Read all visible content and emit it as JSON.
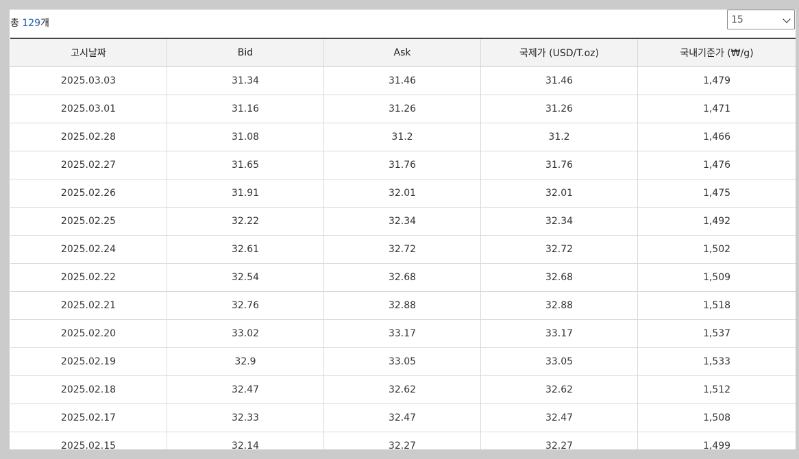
{
  "summary": {
    "prefix": "총 ",
    "count": "129",
    "suffix": "개"
  },
  "page_size_select": {
    "value": "15",
    "icon": "chevron-down-icon"
  },
  "table": {
    "headers": [
      "고시날짜",
      "Bid",
      "Ask",
      "국제가 (USD/T.oz)",
      "국내기준가 (₩/g)"
    ],
    "rows": [
      [
        "2025.03.03",
        "31.34",
        "31.46",
        "31.46",
        "1,479"
      ],
      [
        "2025.03.01",
        "31.16",
        "31.26",
        "31.26",
        "1,471"
      ],
      [
        "2025.02.28",
        "31.08",
        "31.2",
        "31.2",
        "1,466"
      ],
      [
        "2025.02.27",
        "31.65",
        "31.76",
        "31.76",
        "1,476"
      ],
      [
        "2025.02.26",
        "31.91",
        "32.01",
        "32.01",
        "1,475"
      ],
      [
        "2025.02.25",
        "32.22",
        "32.34",
        "32.34",
        "1,492"
      ],
      [
        "2025.02.24",
        "32.61",
        "32.72",
        "32.72",
        "1,502"
      ],
      [
        "2025.02.22",
        "32.54",
        "32.68",
        "32.68",
        "1,509"
      ],
      [
        "2025.02.21",
        "32.76",
        "32.88",
        "32.88",
        "1,518"
      ],
      [
        "2025.02.20",
        "33.02",
        "33.17",
        "33.17",
        "1,537"
      ],
      [
        "2025.02.19",
        "32.9",
        "33.05",
        "33.05",
        "1,533"
      ],
      [
        "2025.02.18",
        "32.47",
        "32.62",
        "32.62",
        "1,512"
      ],
      [
        "2025.02.17",
        "32.33",
        "32.47",
        "32.47",
        "1,508"
      ],
      [
        "2025.02.15",
        "32.14",
        "32.27",
        "32.27",
        "1,499"
      ]
    ]
  }
}
